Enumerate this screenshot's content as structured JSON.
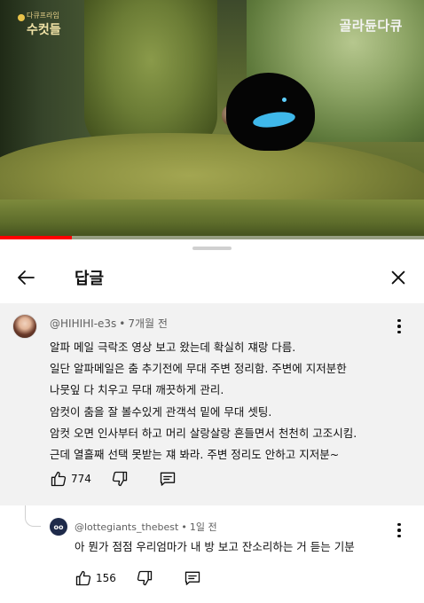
{
  "video": {
    "channel_logo_small": "다큐프라임",
    "channel_logo_big": "수컷들",
    "watermark": "골라듄다큐",
    "progress": 0.17
  },
  "panel": {
    "title": "답글",
    "back_icon": "arrow-left-icon",
    "close_icon": "close-icon"
  },
  "comment": {
    "author": "@HIHIHI-e3s",
    "time": "7개월 전",
    "lines": [
      "알파 메일 극락조 영상 보고 왔는데 확실히 쟤랑 다름.",
      "일단 알파메일은 춤 추기전에 무대 주변 정리함. 주변에 지저분한",
      "나뭇잎 다 치우고 무대 깨끗하게 관리.",
      "암컷이 춤을 잘 볼수있게 관객석 밑에 무대 셋팅.",
      "암컷 오면 인사부터 하고 머리 살랑살랑 흔들면서 천천히 고조시킴.",
      "근데 열흘째 선택 못받는 쟤 봐라. 주변 정리도 안하고 지저분~"
    ],
    "likes": "774"
  },
  "reply": {
    "author": "@lottegiants_thebest",
    "time": "1일 전",
    "avatar_text": "oo",
    "text": "아 뭔가 점점 우리엄마가 내 방 보고 잔소리하는 거 듣는 기분",
    "likes": "156"
  },
  "colors": {
    "comment_bg": "#f2f2f2",
    "progress": "#ff0000",
    "text": "#0f0f0f",
    "meta": "#606060"
  }
}
